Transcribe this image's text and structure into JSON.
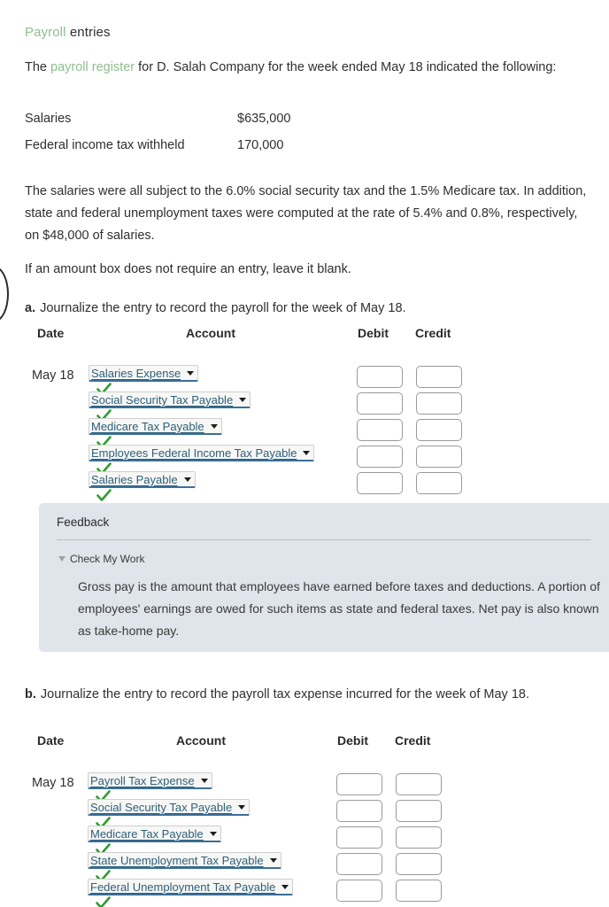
{
  "title": {
    "link_text": "Payroll",
    "rest_text": " entries"
  },
  "intro": {
    "before": "The ",
    "link": "payroll register",
    "after": " for D. Salah Company for the week ended May 18 indicated the following:"
  },
  "amounts": {
    "rows": [
      {
        "label": "Salaries",
        "value": "$635,000"
      },
      {
        "label": "Federal income tax withheld",
        "value": "170,000"
      }
    ]
  },
  "tax_paragraph": "The salaries were all subject to the 6.0% social security tax and the 1.5% Medicare tax. In addition, state and federal unemployment taxes were computed at the rate of 5.4% and 0.8%, respectively, on $48,000 of salaries.",
  "blank_note": "If an amount box does not require an entry, leave it blank.",
  "part_a": {
    "letter": "a.",
    "prompt": "Journalize the entry to record the payroll for the week of May 18.",
    "headers": {
      "date": "Date",
      "account": "Account",
      "debit": "Debit",
      "credit": "Credit"
    },
    "rows": [
      {
        "date": "May 18",
        "account": "Salaries Expense",
        "debit": "",
        "credit": "",
        "status": "correct"
      },
      {
        "date": "",
        "account": "Social Security Tax Payable",
        "debit": "",
        "credit": "",
        "status": "correct"
      },
      {
        "date": "",
        "account": "Medicare Tax Payable",
        "debit": "",
        "credit": "",
        "status": "correct"
      },
      {
        "date": "",
        "account": "Employees Federal Income Tax Payable",
        "debit": "",
        "credit": "",
        "status": "correct"
      },
      {
        "date": "",
        "account": "Salaries Payable",
        "debit": "",
        "credit": "",
        "status": "correct"
      }
    ]
  },
  "feedback": {
    "title": "Feedback",
    "check_my_work": "Check My Work",
    "body": "Gross pay is the amount that employees have earned before taxes and deductions. A portion of employees' earnings are owed for such items as state and federal taxes. Net pay is also known as take-home pay."
  },
  "part_b": {
    "letter": "b.",
    "prompt": "Journalize the entry to record the payroll tax expense incurred for the week of May 18.",
    "headers": {
      "date": "Date",
      "account": "Account",
      "debit": "Debit",
      "credit": "Credit"
    },
    "rows": [
      {
        "date": "May 18",
        "account": "Payroll Tax Expense",
        "debit": "",
        "credit": "",
        "status": "correct"
      },
      {
        "date": "",
        "account": "Social Security Tax Payable",
        "debit": "",
        "credit": "",
        "status": "correct"
      },
      {
        "date": "",
        "account": "Medicare Tax Payable",
        "debit": "",
        "credit": "",
        "status": "correct"
      },
      {
        "date": "",
        "account": "State Unemployment Tax Payable",
        "debit": "",
        "credit": "",
        "status": "correct"
      },
      {
        "date": "",
        "account": "Federal Unemployment Tax Payable",
        "debit": "",
        "credit": "",
        "status": "correct"
      }
    ]
  },
  "colors": {
    "green_link": "#8fbf8f",
    "check_green": "#2f9e2f",
    "select_text": "#2d5f7a",
    "select_underline": "#3a6f9a",
    "feedback_bg": "#dfe5ea",
    "body_text": "#2f2f2f"
  }
}
